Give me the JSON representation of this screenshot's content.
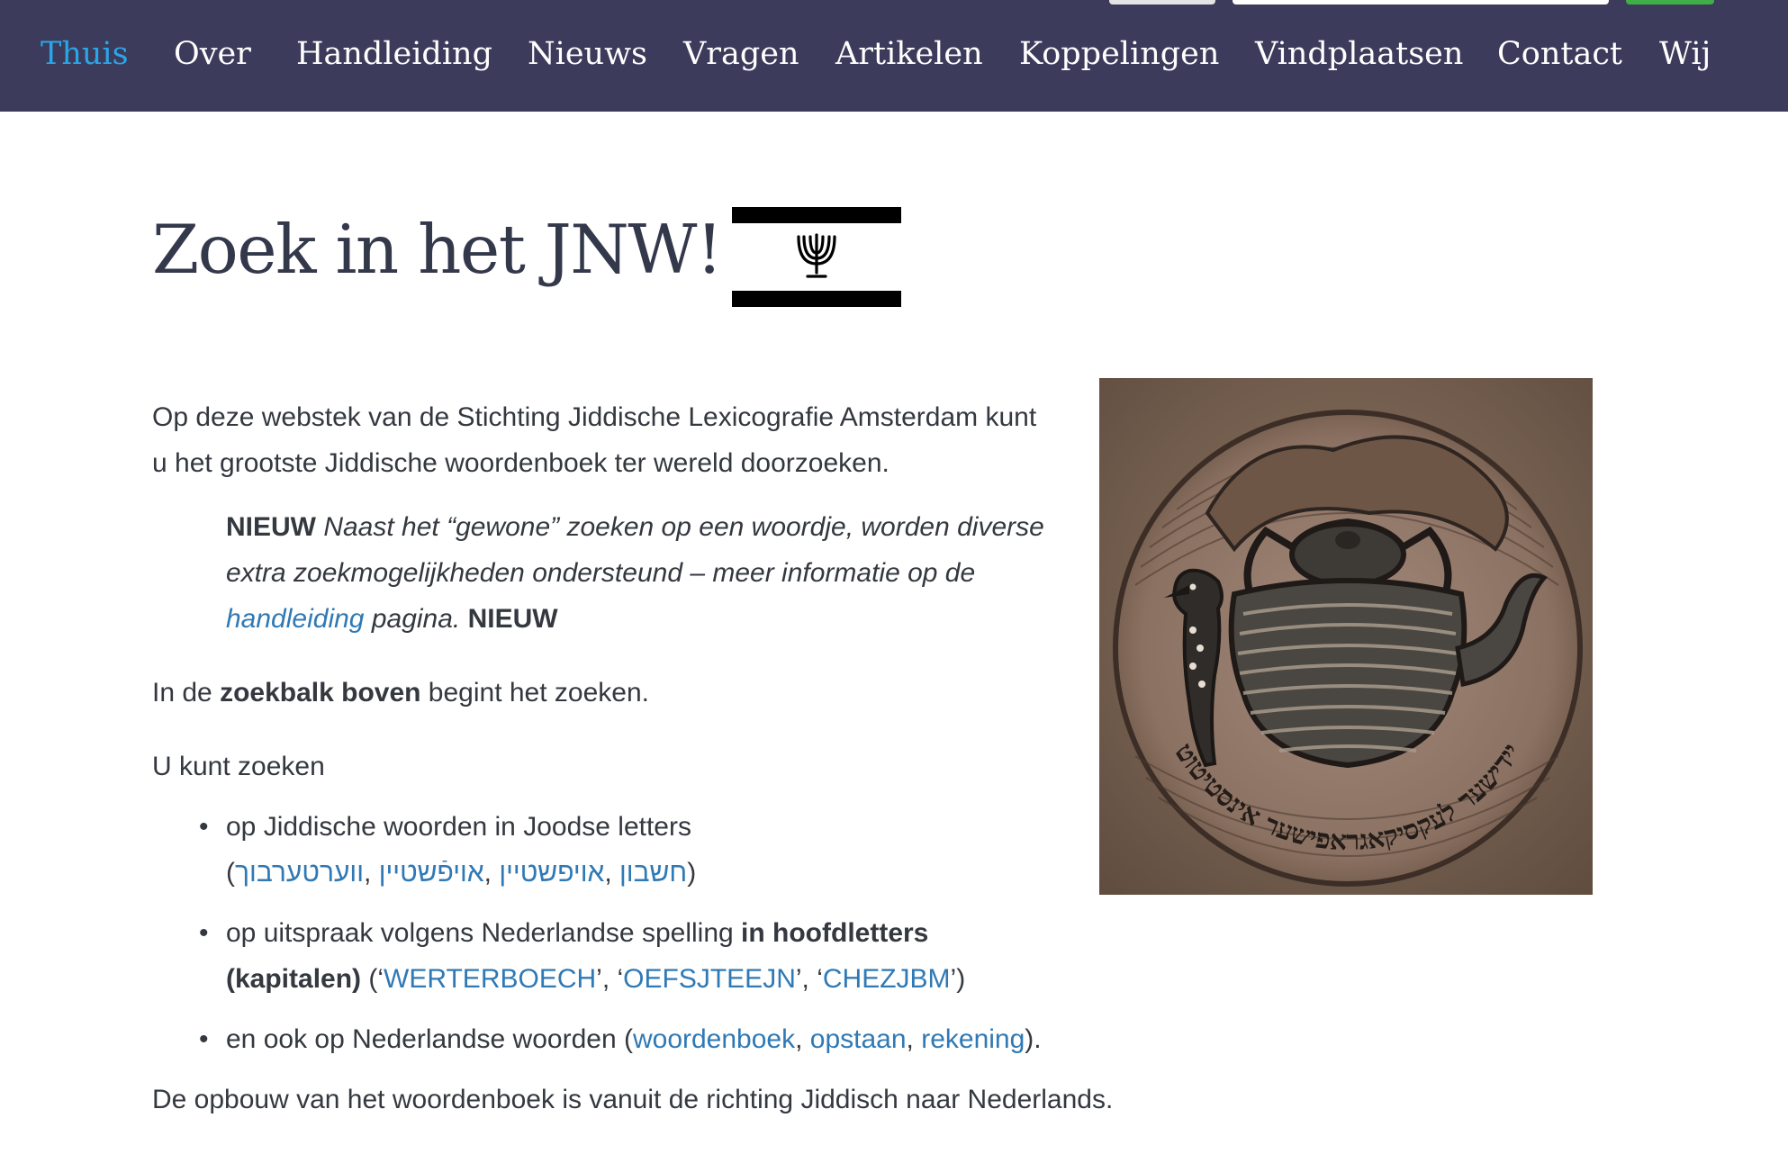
{
  "nav": {
    "items": [
      {
        "label": "Thuis",
        "active": true
      },
      {
        "label": "Over"
      },
      {
        "label": "Handleiding"
      },
      {
        "label": "Nieuws"
      },
      {
        "label": "Vragen"
      },
      {
        "label": "Artikelen"
      },
      {
        "label": "Koppelingen"
      },
      {
        "label": "Vindplaatsen"
      },
      {
        "label": "Contact"
      },
      {
        "label": "Wij"
      }
    ]
  },
  "colors": {
    "nav_background": "#3c3b5b",
    "nav_active": "#2aa6e8",
    "link": "#2f79b5",
    "search_button": "#3fae49"
  },
  "page": {
    "title": "Zoek in het JNW!",
    "flag_icon": "menorah-flag-icon",
    "intro": "Op deze webstek van de Stichting Jiddische Lexicografie Amsterdam kunt u het grootste Jiddische woordenboek ter wereld doorzoeken.",
    "callout": {
      "badge_start": "NIEUW",
      "text_before_link": " Naast het “gewone” zoeken op een woordje, worden diverse extra zoekmogelijkheden ondersteund – meer informatie op de ",
      "link": "handleiding",
      "text_after_link": " pagina.",
      "badge_end": "NIEUW"
    },
    "search_hint": {
      "before": "In de ",
      "bold": "zoekbalk boven",
      "after": " begint het zoeken."
    },
    "options_intro": "U kunt zoeken",
    "options": [
      {
        "text": "op Jiddische woorden in Joodse letters",
        "examples": [
          "ווערטערבוך",
          "אויפֿשטיין",
          "אויפשטיין",
          "חשבון"
        ]
      },
      {
        "text_before": "op uitspraak volgens Nederlandse spelling ",
        "bold": "in hoofdletters (kapitalen)",
        "examples": [
          "WERTERBOECH",
          "OEFSJTEEJN",
          "CHEZJBM"
        ]
      },
      {
        "text_before": "en ook op Nederlandse woorden (",
        "examples": [
          "woordenboek",
          "opstaan",
          "rekening"
        ],
        "text_after": ")."
      }
    ],
    "direction_note": "De opbouw van het woordenboek is vanuit de richting Jiddisch naar Nederlands.",
    "seal_image": "woodcut-seal-teapot-woodpecker-image",
    "seal_inscription": "יידישער לעקסיקאגראפישער אינסטיטוט"
  }
}
